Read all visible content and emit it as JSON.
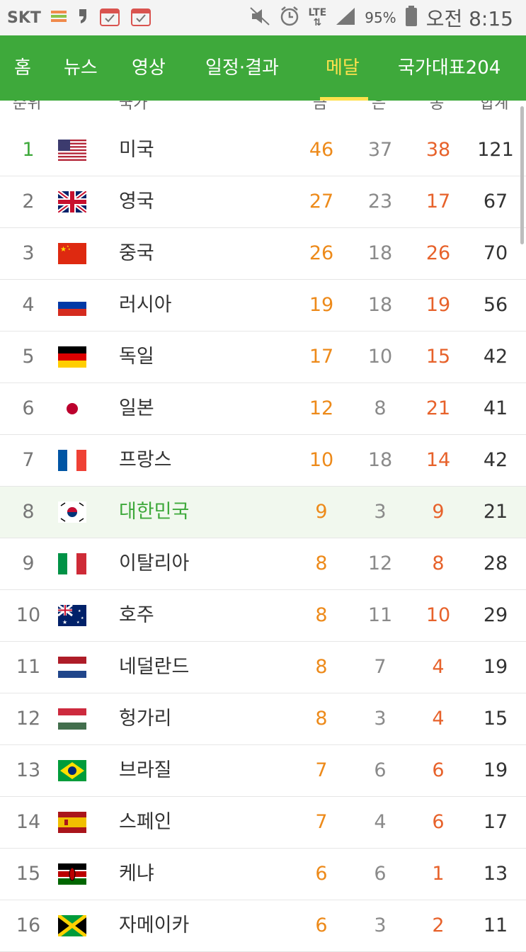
{
  "status_bar": {
    "carrier": "SKT",
    "network": "LTE",
    "battery": "95%",
    "time": "오전 8:15"
  },
  "nav": {
    "tabs": [
      {
        "label": "홈"
      },
      {
        "label": "뉴스"
      },
      {
        "label": "영상"
      },
      {
        "label": "일정·결과"
      },
      {
        "label": "메달",
        "active": true
      },
      {
        "label": "국가대표204"
      }
    ]
  },
  "table": {
    "headers": [
      "순위",
      "국가",
      "금",
      "은",
      "동",
      "합계"
    ],
    "rows": [
      {
        "rank": "1",
        "country": "미국",
        "flag": "usa",
        "gold": "46",
        "silver": "37",
        "bronze": "38",
        "total": "121"
      },
      {
        "rank": "2",
        "country": "영국",
        "flag": "uk",
        "gold": "27",
        "silver": "23",
        "bronze": "17",
        "total": "67"
      },
      {
        "rank": "3",
        "country": "중국",
        "flag": "china",
        "gold": "26",
        "silver": "18",
        "bronze": "26",
        "total": "70"
      },
      {
        "rank": "4",
        "country": "러시아",
        "flag": "russia",
        "gold": "19",
        "silver": "18",
        "bronze": "19",
        "total": "56"
      },
      {
        "rank": "5",
        "country": "독일",
        "flag": "germany",
        "gold": "17",
        "silver": "10",
        "bronze": "15",
        "total": "42"
      },
      {
        "rank": "6",
        "country": "일본",
        "flag": "japan",
        "gold": "12",
        "silver": "8",
        "bronze": "21",
        "total": "41"
      },
      {
        "rank": "7",
        "country": "프랑스",
        "flag": "france",
        "gold": "10",
        "silver": "18",
        "bronze": "14",
        "total": "42"
      },
      {
        "rank": "8",
        "country": "대한민국",
        "flag": "korea",
        "gold": "9",
        "silver": "3",
        "bronze": "9",
        "total": "21",
        "highlight": true
      },
      {
        "rank": "9",
        "country": "이탈리아",
        "flag": "italy",
        "gold": "8",
        "silver": "12",
        "bronze": "8",
        "total": "28"
      },
      {
        "rank": "10",
        "country": "호주",
        "flag": "australia",
        "gold": "8",
        "silver": "11",
        "bronze": "10",
        "total": "29"
      },
      {
        "rank": "11",
        "country": "네덜란드",
        "flag": "netherlands",
        "gold": "8",
        "silver": "7",
        "bronze": "4",
        "total": "19"
      },
      {
        "rank": "12",
        "country": "헝가리",
        "flag": "hungary",
        "gold": "8",
        "silver": "3",
        "bronze": "4",
        "total": "15"
      },
      {
        "rank": "13",
        "country": "브라질",
        "flag": "brazil",
        "gold": "7",
        "silver": "6",
        "bronze": "6",
        "total": "19"
      },
      {
        "rank": "14",
        "country": "스페인",
        "flag": "spain",
        "gold": "7",
        "silver": "4",
        "bronze": "6",
        "total": "17"
      },
      {
        "rank": "15",
        "country": "케냐",
        "flag": "kenya",
        "gold": "6",
        "silver": "6",
        "bronze": "1",
        "total": "13"
      },
      {
        "rank": "16",
        "country": "자메이카",
        "flag": "jamaica",
        "gold": "6",
        "silver": "3",
        "bronze": "2",
        "total": "11"
      }
    ]
  },
  "colors": {
    "brand_green": "#3ea93b",
    "active_tab": "#ffe14d",
    "gold": "#ed8a1a",
    "silver": "#8a8a8a",
    "bronze": "#e7622b"
  }
}
